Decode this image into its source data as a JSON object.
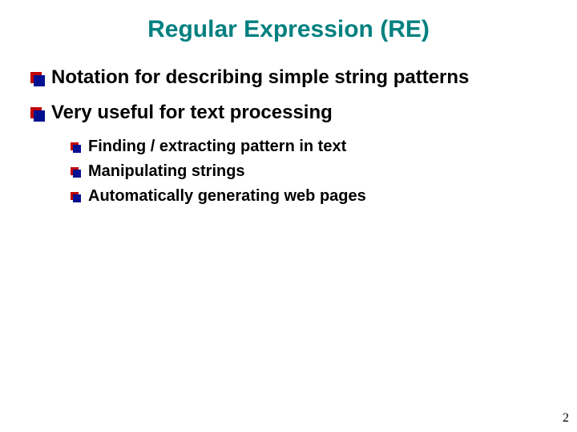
{
  "title": "Regular Expression (RE)",
  "bullets_level1": [
    "Notation for describing simple string patterns",
    "Very useful for text processing"
  ],
  "bullets_level2": [
    "Finding / extracting pattern in text",
    "Manipulating strings",
    "Automatically generating web pages"
  ],
  "page_number": "2"
}
